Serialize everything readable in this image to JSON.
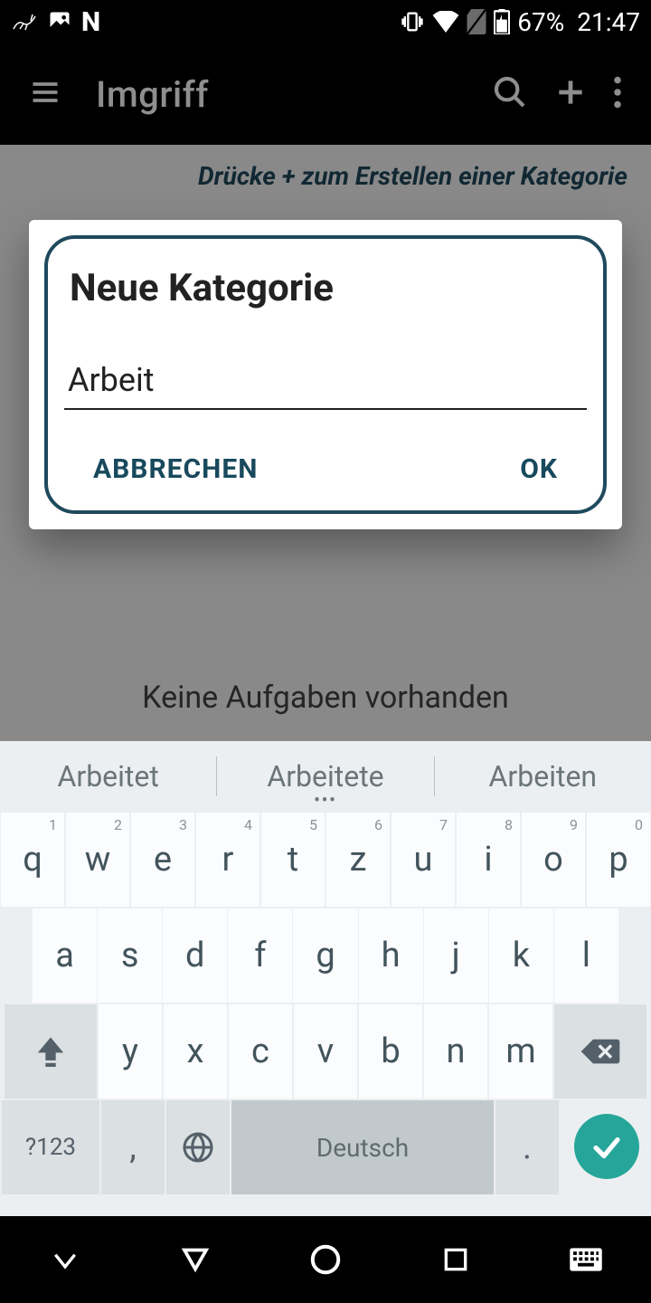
{
  "status": {
    "battery": "67%",
    "time": "21:47"
  },
  "appbar": {
    "title": "Imgriff"
  },
  "content": {
    "hint": "Drücke + zum Erstellen einer Kategorie",
    "empty": "Keine Aufgaben vorhanden"
  },
  "dialog": {
    "title": "Neue Kategorie",
    "input_value": "Arbeit",
    "cancel": "ABBRECHEN",
    "ok": "OK"
  },
  "keyboard": {
    "suggestions": [
      "Arbeitet",
      "Arbeitete",
      "Arbeiten"
    ],
    "row1": [
      "q",
      "w",
      "e",
      "r",
      "t",
      "z",
      "u",
      "i",
      "o",
      "p"
    ],
    "row1_nums": [
      "1",
      "2",
      "3",
      "4",
      "5",
      "6",
      "7",
      "8",
      "9",
      "0"
    ],
    "row2": [
      "a",
      "s",
      "d",
      "f",
      "g",
      "h",
      "j",
      "k",
      "l"
    ],
    "row3": [
      "y",
      "x",
      "c",
      "v",
      "b",
      "n",
      "m"
    ],
    "symbols_key": "?123",
    "comma_key": ",",
    "space_label": "Deutsch",
    "period_key": "."
  }
}
